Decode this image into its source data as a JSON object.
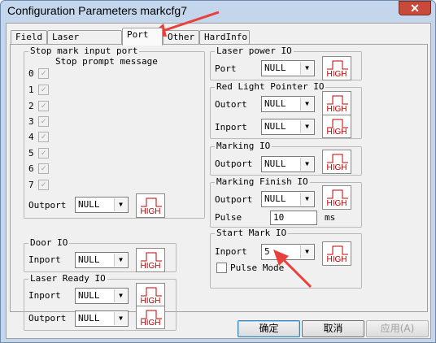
{
  "window": {
    "title": "Configuration Parameters markcfg7",
    "close_label": "✕"
  },
  "tabs": [
    {
      "label": "Field",
      "active": false
    },
    {
      "label": "Laser Control",
      "active": false
    },
    {
      "label": "Port",
      "active": true
    },
    {
      "label": "Other",
      "active": false
    },
    {
      "label": "HardInfo",
      "active": false
    }
  ],
  "stop_mark": {
    "title": "Stop mark input port",
    "prompt": "Stop prompt message",
    "rows": [
      {
        "num": "0",
        "checked": true
      },
      {
        "num": "1",
        "checked": true
      },
      {
        "num": "2",
        "checked": true
      },
      {
        "num": "3",
        "checked": true
      },
      {
        "num": "4",
        "checked": true
      },
      {
        "num": "5",
        "checked": true
      },
      {
        "num": "6",
        "checked": true
      },
      {
        "num": "7",
        "checked": true
      }
    ],
    "outport_label": "Outport",
    "outport_value": "NULL"
  },
  "door_io": {
    "title": "Door IO",
    "inport_label": "Inport",
    "inport_value": "NULL"
  },
  "laser_ready_io": {
    "title": "Laser Ready IO",
    "inport_label": "Inport",
    "inport_value": "NULL",
    "outport_label": "Outport",
    "outport_value": "NULL"
  },
  "laser_power_io": {
    "title": "Laser power IO",
    "port_label": "Port",
    "port_value": "NULL"
  },
  "red_light_io": {
    "title": "Red Light Pointer IO",
    "outport_label": "Outort",
    "outport_value": "NULL",
    "inport_label": "Inport",
    "inport_value": "NULL"
  },
  "marking_io": {
    "title": "Marking IO",
    "outport_label": "Outport",
    "outport_value": "NULL"
  },
  "marking_finish_io": {
    "title": "Marking Finish IO",
    "outport_label": "Outport",
    "outport_value": "NULL",
    "pulse_label": "Pulse",
    "pulse_value": "10",
    "pulse_unit": "ms"
  },
  "start_mark_io": {
    "title": "Start Mark IO",
    "inport_label": "Inport",
    "inport_value": "5",
    "pulse_mode_label": "Pulse Mode",
    "pulse_mode_checked": false
  },
  "level_button_label": "HIGH",
  "buttons": {
    "ok": "确定",
    "cancel": "取消",
    "apply": "应用(A)"
  },
  "colors": {
    "annotation_arrow": "#e8403a",
    "level_red": "#c00000"
  }
}
